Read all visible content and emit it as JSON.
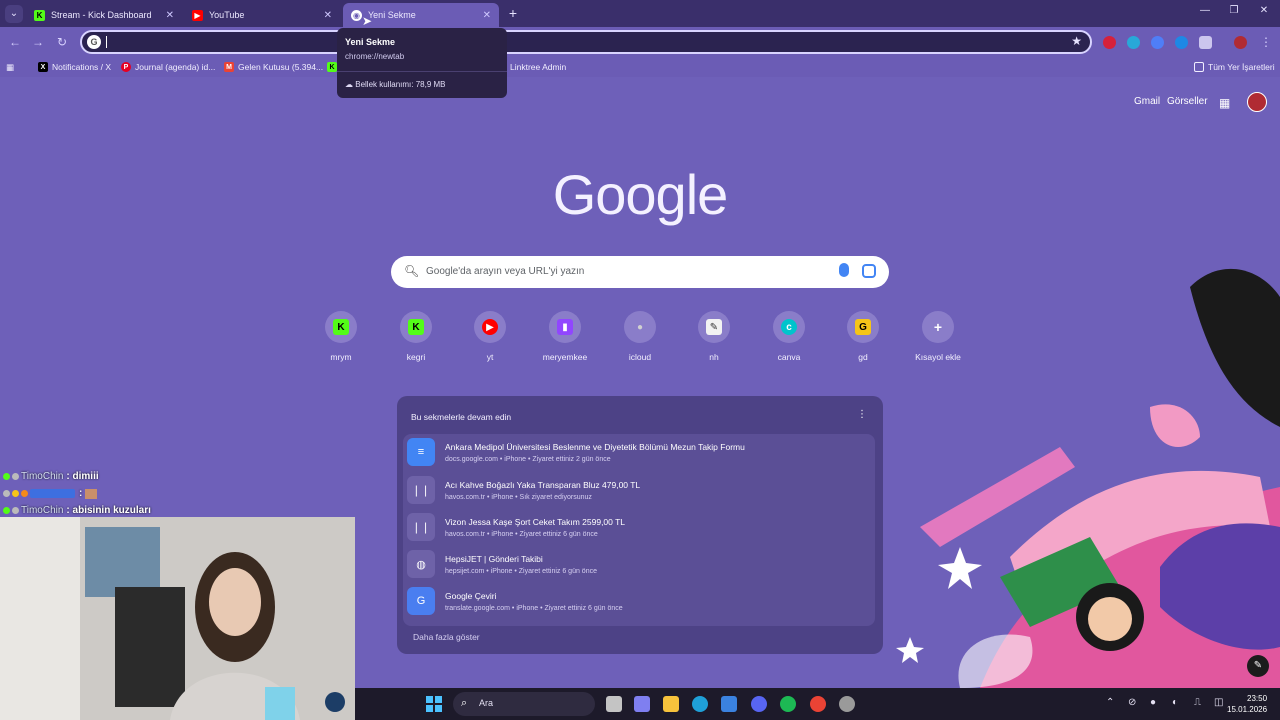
{
  "browser": {
    "tabs": [
      {
        "label": "Stream - Kick Dashboard",
        "icon": "kick-icon",
        "active": false
      },
      {
        "label": "YouTube",
        "icon": "youtube-icon",
        "active": false
      },
      {
        "label": "Yeni Sekme",
        "icon": "chrome-icon",
        "active": true
      }
    ],
    "hovercard": {
      "title": "Yeni Sekme",
      "url": "chrome://newtab",
      "memory": "Bellek kullanımı: 78,9 MB"
    },
    "bookmarks": [
      {
        "label": "Notifications / X",
        "icon": "x-icon",
        "color": "#000000"
      },
      {
        "label": "Journal (agenda) id...",
        "icon": "pinterest-icon",
        "color": "#e60023"
      },
      {
        "label": "Gelen Kutusu (5.394...",
        "icon": "gmail-icon",
        "color": "#ea4335"
      },
      {
        "label": "Linktree Admin",
        "icon": "linktree-icon",
        "color": "#43e660"
      }
    ],
    "all_bookmarks": "Tüm Yer İşaretleri"
  },
  "ntp": {
    "gmail": "Gmail",
    "images": "Görseller",
    "logo": "Google",
    "search_placeholder": "Google'da arayın veya URL'yi yazın",
    "shortcuts": [
      {
        "label": "mrym",
        "icon": "kick-icon",
        "color": "#53fc18"
      },
      {
        "label": "kegri",
        "icon": "kick-icon",
        "color": "#53fc18"
      },
      {
        "label": "yt",
        "icon": "youtube-icon",
        "color": "#ff0000"
      },
      {
        "label": "meryemkee",
        "icon": "twitch-icon",
        "color": "#9146ff"
      },
      {
        "label": "icloud",
        "icon": "apple-icon",
        "color": "#d0d0d0"
      },
      {
        "label": "nh",
        "icon": "nh-icon",
        "color": "#f2f2f2"
      },
      {
        "label": "canva",
        "icon": "canva-icon",
        "color": "#00c4cc"
      },
      {
        "label": "gd",
        "icon": "gd-icon",
        "color": "#f5c518"
      },
      {
        "label": "Kısayol ekle",
        "icon": "plus-icon",
        "color": "#ffffff"
      }
    ],
    "resume": {
      "title": "Bu sekmelerle devam edin",
      "items": [
        {
          "name": "Ankara Medipol Üniversitesi Beslenme ve Diyetetik Bölümü Mezun Takip Formu",
          "meta": "docs.google.com • iPhone • Ziyaret ettiniz 2 gün önce",
          "icon": "google-docs-icon"
        },
        {
          "name": "Acı Kahve Boğazlı Yaka Transparan Bluz 479,00 TL",
          "meta": "havos.com.tr • iPhone • Sık ziyaret ediyorsunuz",
          "icon": "havos-icon"
        },
        {
          "name": "Vizon Jessa Kaşe Şort Ceket Takım 2599,00 TL",
          "meta": "havos.com.tr • iPhone • Ziyaret ettiniz 6 gün önce",
          "icon": "havos-icon"
        },
        {
          "name": "HepsiJET | Gönderi Takibi",
          "meta": "hepsijet.com • iPhone • Ziyaret ettiniz 6 gün önce",
          "icon": "globe-icon"
        },
        {
          "name": "Google Çeviri",
          "meta": "translate.google.com • iPhone • Ziyaret ettiniz 6 gün önce",
          "icon": "google-translate-icon"
        }
      ],
      "more": "Daha fazla göster"
    }
  },
  "chat": [
    {
      "user": "TimoChin",
      "msg": "dimiii"
    },
    {
      "user": "",
      "msg": ""
    },
    {
      "user": "TimoChin",
      "msg": "abisinin kuzuları"
    }
  ],
  "taskbar": {
    "search": "Ara",
    "time": "23:50",
    "date": "15.01.2026"
  }
}
